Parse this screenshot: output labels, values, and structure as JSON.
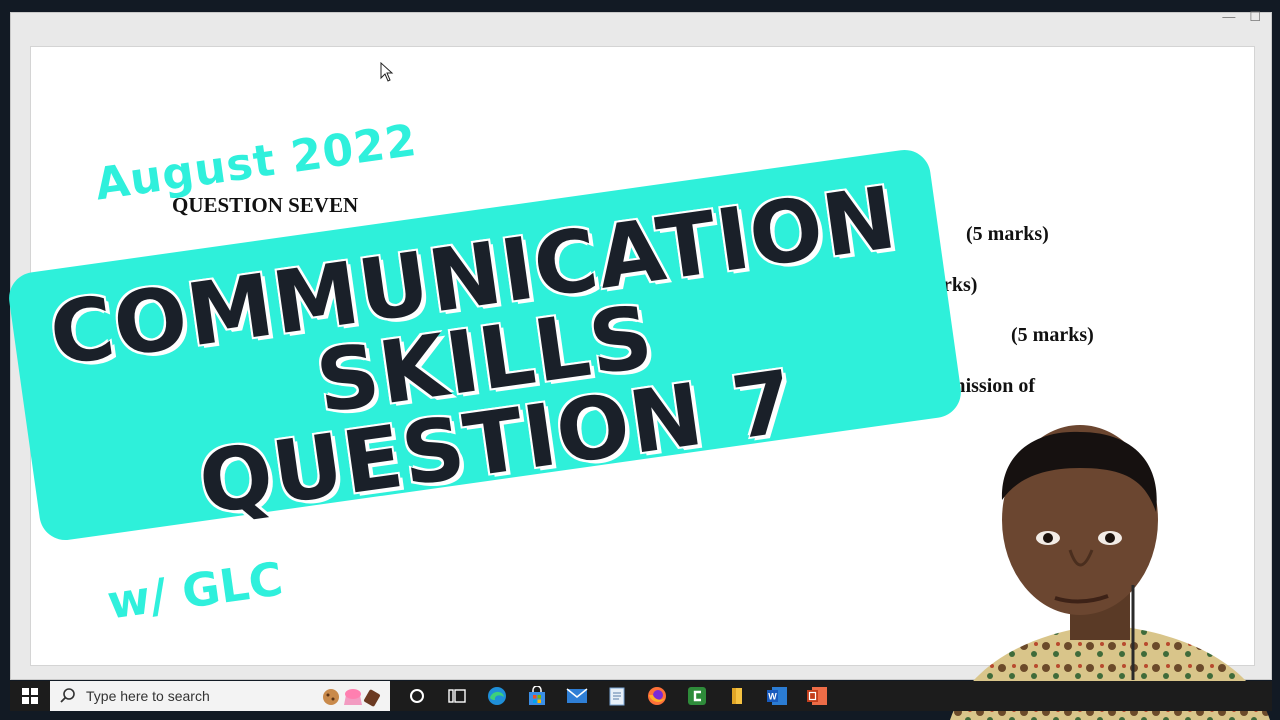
{
  "overlay": {
    "date_label": "August 2022",
    "title_lines": [
      "COMMUNICATION",
      "SKILLS",
      "QUESTION 7"
    ],
    "host_label": "w/ GLC"
  },
  "document": {
    "question_heading": "QUESTION SEVEN",
    "marks": [
      "(5 marks)",
      "arks)",
      "(5 marks)",
      "nsmission of"
    ]
  },
  "taskbar": {
    "search_placeholder": "Type here to search"
  },
  "colors": {
    "accent": "#2ef0da",
    "title_text": "#1a2029",
    "frame": "#121a24",
    "taskbar": "#1c1c1c"
  },
  "icons": [
    "windows-start-icon",
    "search-icon",
    "task-view-icon",
    "edge-icon",
    "store-icon",
    "mail-icon",
    "notepad-icon",
    "firefox-icon",
    "camtasia-icon",
    "file-explorer-icon",
    "word-icon",
    "powerpoint-icon"
  ]
}
